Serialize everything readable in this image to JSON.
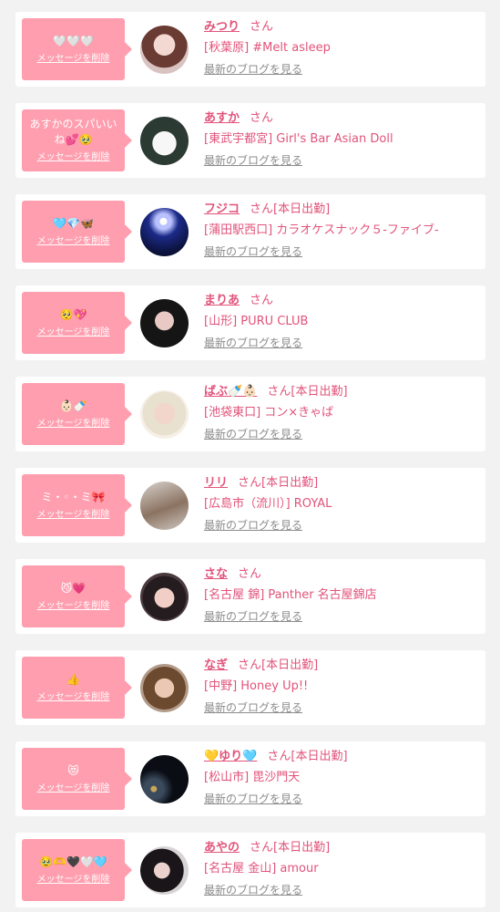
{
  "delete_label": "メッセージを削除",
  "blog_label": "最新のブログを見る",
  "honorific": "さん",
  "colors": {
    "accent": "#e2537a",
    "bubble": "#ff9eaf",
    "muted": "#8c8c8c",
    "background": "#f2f2f2"
  },
  "messages": [
    {
      "message": "🤍🤍🤍",
      "name": "みつり",
      "status": "",
      "shop": "[秋葉原] #Melt asleep"
    },
    {
      "message": "あすかのスパいいね💕🥹",
      "name": "あすか",
      "status": "",
      "shop": "[東武宇都宮] Girl's Bar Asian Doll"
    },
    {
      "message": "🩵💎🦋",
      "name": "フジコ",
      "status": "[本日出勤]",
      "shop": "[蒲田駅西口] カラオケスナック５-ファイブ-"
    },
    {
      "message": "🥺💖",
      "name": "まりあ",
      "status": "",
      "shop": "[山形] PURU CLUB"
    },
    {
      "message": "👶🏻🍼",
      "name": "ばぶ🍼👶🏻",
      "status": "[本日出勤]",
      "shop": "[池袋東口] コン×きゃば"
    },
    {
      "message": "ミ・◦・ミ🎀",
      "name": "リリ",
      "status": "[本日出勤]",
      "shop": "[広島市（流川）] ROYAL"
    },
    {
      "message": "😼💗",
      "name": "さな",
      "status": "",
      "shop": "[名古屋 錦] Panther 名古屋錦店"
    },
    {
      "message": "👍",
      "name": "なぎ",
      "status": "[本日出勤]",
      "shop": "[中野] Honey Up!!"
    },
    {
      "message": "😻",
      "name": "💛ゆり🩵",
      "status": "[本日出勤]",
      "shop": "[松山市] 毘沙門天"
    },
    {
      "message": "🥹🫶🖤🤍🩵",
      "name": "あやの",
      "status": "[本日出勤]",
      "shop": "[名古屋 金山] amour"
    }
  ]
}
